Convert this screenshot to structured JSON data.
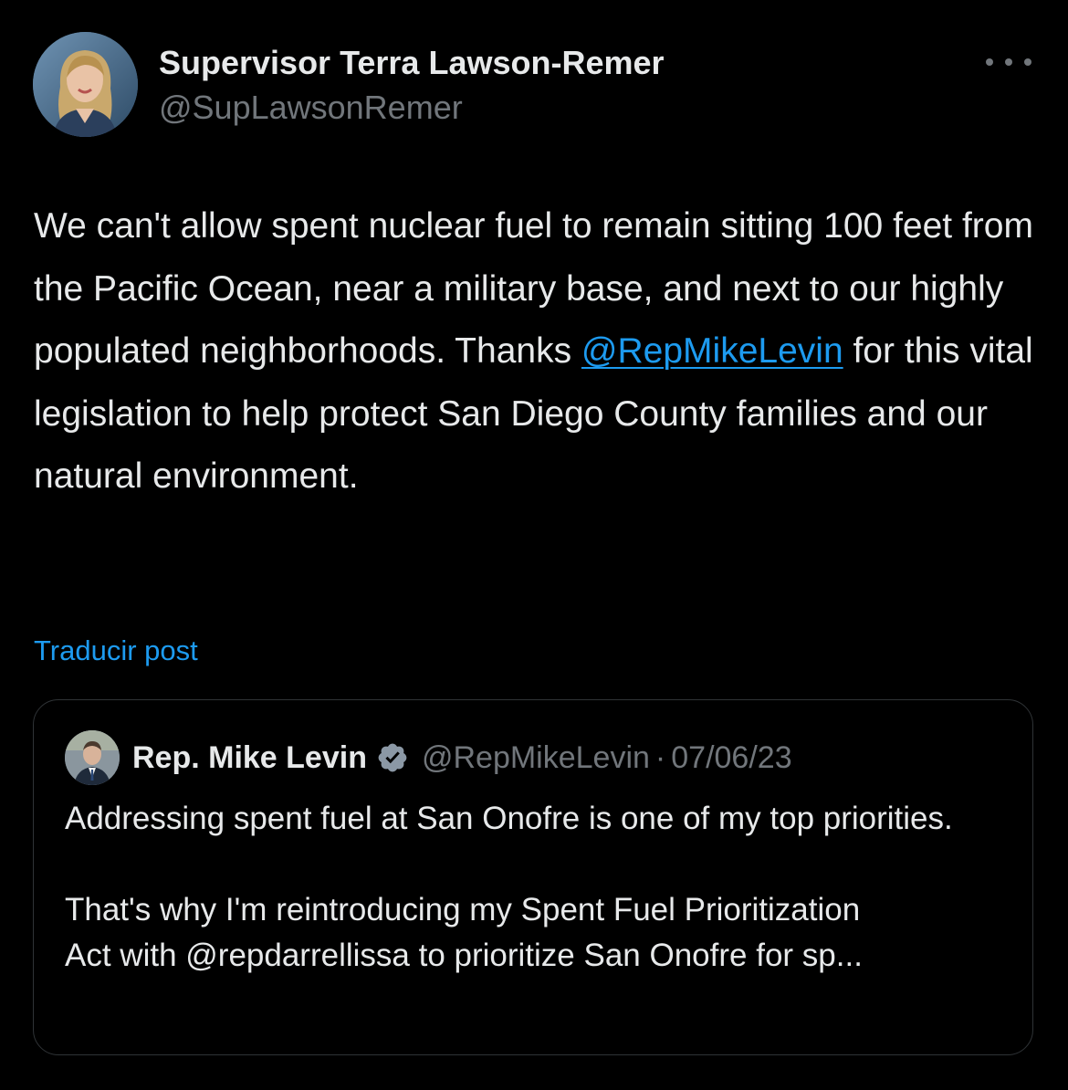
{
  "post": {
    "author_name": "Supervisor Terra Lawson-Remer",
    "author_handle": "@SupLawsonRemer",
    "text_before_mention": "We can't allow spent nuclear fuel to remain sitting 100 feet from the Pacific Ocean, near a military base, and next to our highly populated neighborhoods. Thanks ",
    "mention": "@RepMikeLevin",
    "text_after_mention": " for this vital legislation to help protect San Diego County families and our natural environment.",
    "translate_label": "Traducir post",
    "more_icon": "more-horizontal-icon"
  },
  "quote": {
    "author_name": "Rep. Mike Levin",
    "verified_icon": "verified-badge-icon",
    "author_handle": "@RepMikeLevin",
    "separator": "·",
    "date": "07/06/23",
    "paragraph1": "Addressing spent fuel at San Onofre is one of my top priorities.",
    "paragraph2_line1": "That's why I'm reintroducing my Spent Fuel Prioritization",
    "paragraph2_line2": "Act with @repdarrellissa to prioritize San Onofre for sp..."
  },
  "colors": {
    "background": "#000000",
    "text_primary": "#e7e9ea",
    "text_secondary": "#71767b",
    "link": "#1d9bf0",
    "border": "#2f3336"
  }
}
